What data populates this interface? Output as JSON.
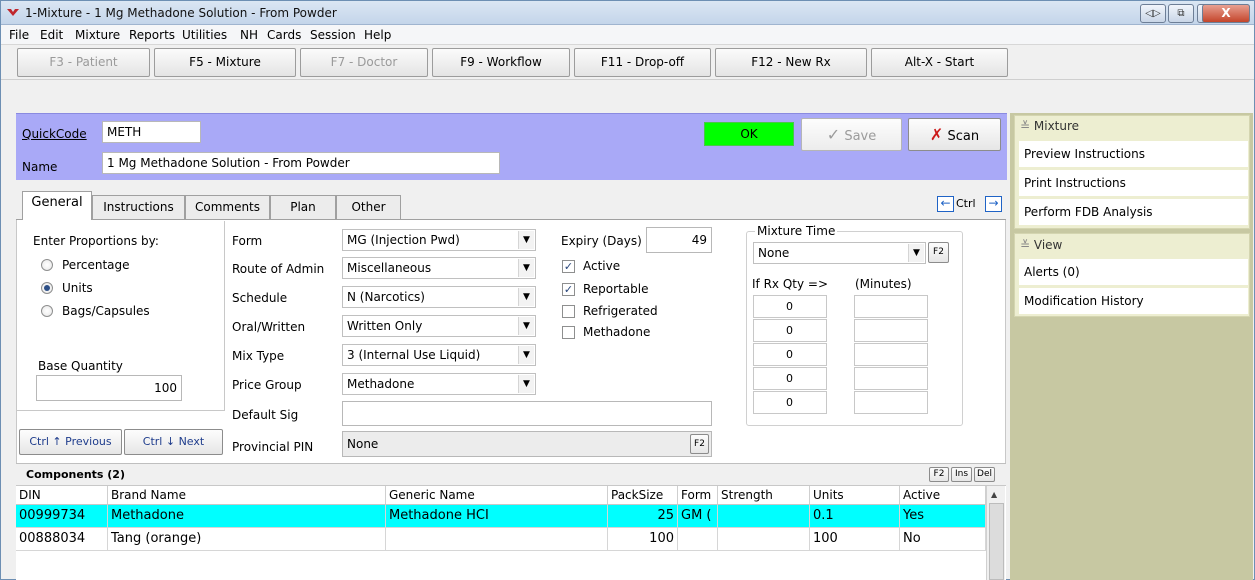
{
  "window": {
    "title": "1-Mixture - 1 Mg Methadone Solution - From Powder",
    "controls": {
      "extra1": "◁▷",
      "extra2": "⧉",
      "minimize": "—",
      "maximize": "□",
      "close": "X"
    }
  },
  "menu": [
    "File",
    "Edit",
    "Mixture",
    "Reports",
    "Utilities",
    "NH",
    "Cards",
    "Session",
    "Help"
  ],
  "fkeys": [
    {
      "label": "F3 - Patient",
      "enabled": false
    },
    {
      "label": "F5 - Mixture",
      "enabled": true
    },
    {
      "label": "F7 - Doctor",
      "enabled": false
    },
    {
      "label": "F9 - Workflow",
      "enabled": true
    },
    {
      "label": "F11 - Drop-off",
      "enabled": true
    },
    {
      "label": "F12 - New Rx",
      "enabled": true
    },
    {
      "label": "Alt-X - Start",
      "enabled": true
    }
  ],
  "header": {
    "quickcode_label": "QuickCode",
    "quickcode_value": "METH",
    "name_label": "Name",
    "name_value": "1 Mg Methadone Solution - From Powder",
    "status": "OK",
    "save_label": "Save",
    "scan_label": "Scan"
  },
  "tabs": [
    "General",
    "Instructions",
    "Comments",
    "Plan",
    "Other"
  ],
  "tab_nav": {
    "ctrl_label": "Ctrl"
  },
  "general": {
    "proportions_label": "Enter Proportions by:",
    "proportions_options": [
      "Percentage",
      "Units",
      "Bags/Capsules"
    ],
    "proportions_selected": "Units",
    "base_quantity_label": "Base Quantity",
    "base_quantity": "100",
    "prev_label": "Ctrl ↑ Previous",
    "next_label": "Ctrl ↓ Next",
    "form_label": "Form",
    "form_value": "MG (Injection Pwd)",
    "route_label": "Route of Admin",
    "route_value": "Miscellaneous",
    "schedule_label": "Schedule",
    "schedule_value": "N (Narcotics)",
    "oral_label": "Oral/Written",
    "oral_value": "Written Only",
    "mixtype_label": "Mix Type",
    "mixtype_value": "3 (Internal Use Liquid)",
    "pricegroup_label": "Price Group",
    "pricegroup_value": "Methadone",
    "defaultsig_label": "Default Sig",
    "defaultsig_value": "",
    "pin_label": "Provincial PIN",
    "pin_value": "None",
    "f2": "F2",
    "expiry_label": "Expiry (Days)",
    "expiry_value": "49",
    "flags": [
      {
        "label": "Active",
        "checked": true
      },
      {
        "label": "Reportable",
        "checked": true
      },
      {
        "label": "Refrigerated",
        "checked": false
      },
      {
        "label": "Methadone",
        "checked": false
      }
    ],
    "mixture_time_label": "Mixture Time",
    "mixture_time_value": "None",
    "rx_qty_label": "If Rx Qty =>",
    "minutes_label": "(Minutes)",
    "rx_qty_values": [
      "0",
      "0",
      "0",
      "0",
      "0"
    ]
  },
  "components": {
    "title": "Components (2)",
    "buttons": [
      "F2",
      "Ins",
      "Del"
    ],
    "columns": [
      "DIN",
      "Brand Name",
      "Generic Name",
      "PackSize",
      "Form",
      "Strength",
      "Units",
      "Active"
    ],
    "rows": [
      {
        "din": "00999734",
        "brand": "Methadone",
        "generic": "Methadone HCI",
        "packsize": "25",
        "form": "GM (",
        "strength": "",
        "units": "0.1",
        "active": "Yes",
        "selected": true
      },
      {
        "din": "00888034",
        "brand": "Tang (orange)",
        "generic": "",
        "packsize": "100",
        "form": "",
        "strength": "",
        "units": "100",
        "active": "No",
        "selected": false
      }
    ]
  },
  "side": {
    "mixture_title": "Mixture",
    "mixture_items": [
      "Preview Instructions",
      "Print Instructions",
      "Perform FDB Analysis"
    ],
    "view_title": "View",
    "view_items": [
      "Alerts (0)",
      "Modification History"
    ]
  },
  "colors": {
    "header_bg": "#a9a9f7",
    "ok_bg": "#00ff00",
    "selected_row": "#00ffff",
    "side_bg": "#c7c8a2"
  }
}
